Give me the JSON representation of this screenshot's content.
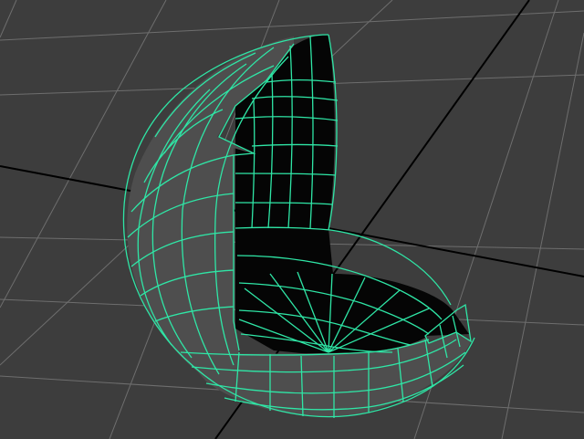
{
  "viewport": {
    "kind": "3d-perspective-viewport",
    "background_color": "#3d3d3d",
    "grid_color": "#6e6e6e",
    "axis_line_color": "#000000",
    "grid_visible": true
  },
  "object": {
    "kind": "sphere-cutaway",
    "wireframe_on_shaded": true,
    "selected": true,
    "wireframe_color": "#2fe6a6",
    "outer_shell_color": "#4e4e4e",
    "inner_cavity_color": "#050505"
  }
}
